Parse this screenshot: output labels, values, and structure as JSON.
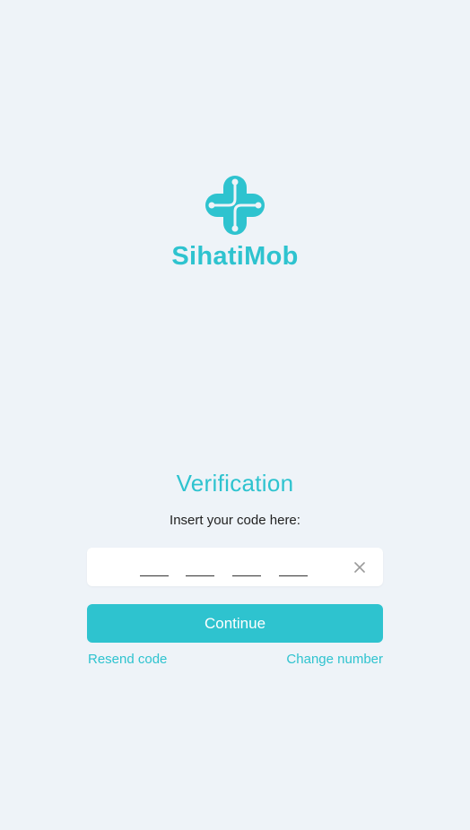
{
  "brand": {
    "name": "SihatiMob",
    "logo_icon": "medical-cross-logo-icon"
  },
  "verification": {
    "title": "Verification",
    "instruction": "Insert your code here:",
    "code_digits": [
      "",
      "",
      "",
      ""
    ],
    "clear_icon": "close-icon"
  },
  "actions": {
    "continue_label": "Continue",
    "resend_label": "Resend code",
    "change_number_label": "Change number"
  },
  "colors": {
    "accent": "#2ec3cf",
    "background": "#eef3f8",
    "field_background": "#ffffff",
    "text": "#222222"
  }
}
